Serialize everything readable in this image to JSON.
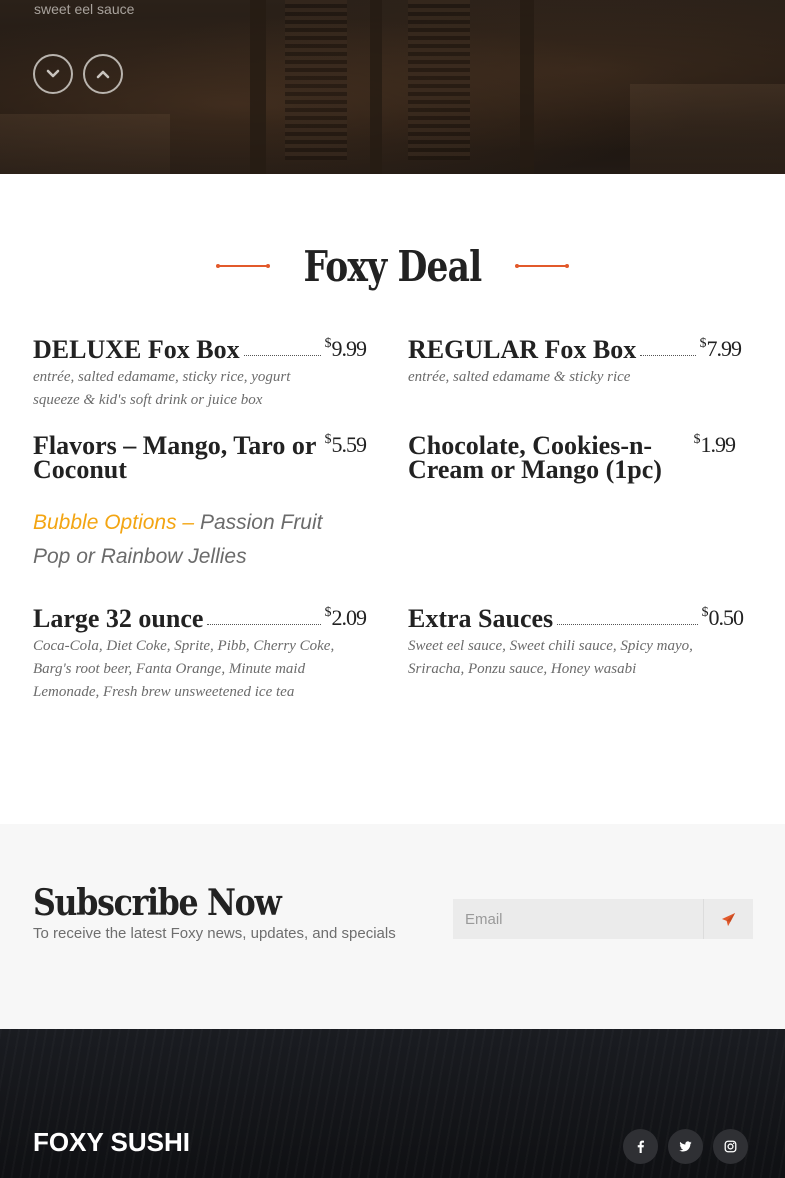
{
  "hero": {
    "caption": "sweet eel sauce",
    "scroll_down_icon": "chevron-down-icon",
    "scroll_up_icon": "chevron-up-icon"
  },
  "menu": {
    "title": "Foxy Deal",
    "items": [
      {
        "name": "DELUXE Fox Box",
        "currency": "$",
        "price": "9.99",
        "description": "entrée, salted edamame, sticky rice, yogurt squeeze & kid's soft drink or juice box"
      },
      {
        "name": "REGULAR Fox Box",
        "currency": "$",
        "price": "7.99",
        "description": "entrée, salted edamame & sticky rice"
      },
      {
        "name": "Flavors – Mango, Taro or Coconut",
        "currency": "$",
        "price": "5.59",
        "description": ""
      },
      {
        "name": "Chocolate, Cookies-n-Cream or Mango (1pc)",
        "currency": "$",
        "price": "1.99",
        "description": ""
      },
      {
        "name": "Large 32 ounce",
        "currency": "$",
        "price": "2.09",
        "description": "Coca-Cola, Diet Coke, Sprite, Pibb, Cherry Coke, Barg's root beer, Fanta Orange, Minute maid Lemonade, Fresh brew unsweetened ice tea"
      },
      {
        "name": "Extra Sauces",
        "currency": "$",
        "price": "0.50",
        "description": "Sweet eel sauce, Sweet chili sauce, Spicy mayo, Sriracha, Ponzu sauce, Honey wasabi"
      }
    ],
    "bubble_label": "Bubble Options –",
    "bubble_text": " Passion Fruit Pop or Rainbow Jellies"
  },
  "subscribe": {
    "title": "Subscribe Now",
    "text": "To receive the latest Foxy news, updates, and specials",
    "email_placeholder": "Email",
    "send_icon": "paper-plane-icon"
  },
  "footer": {
    "brand": "FOXY SUSHI",
    "social": [
      "facebook-icon",
      "twitter-icon",
      "instagram-icon"
    ]
  },
  "colors": {
    "accent": "#e2592b",
    "bubble_highlight": "#f3a512",
    "footer_bg": "#16171b"
  }
}
